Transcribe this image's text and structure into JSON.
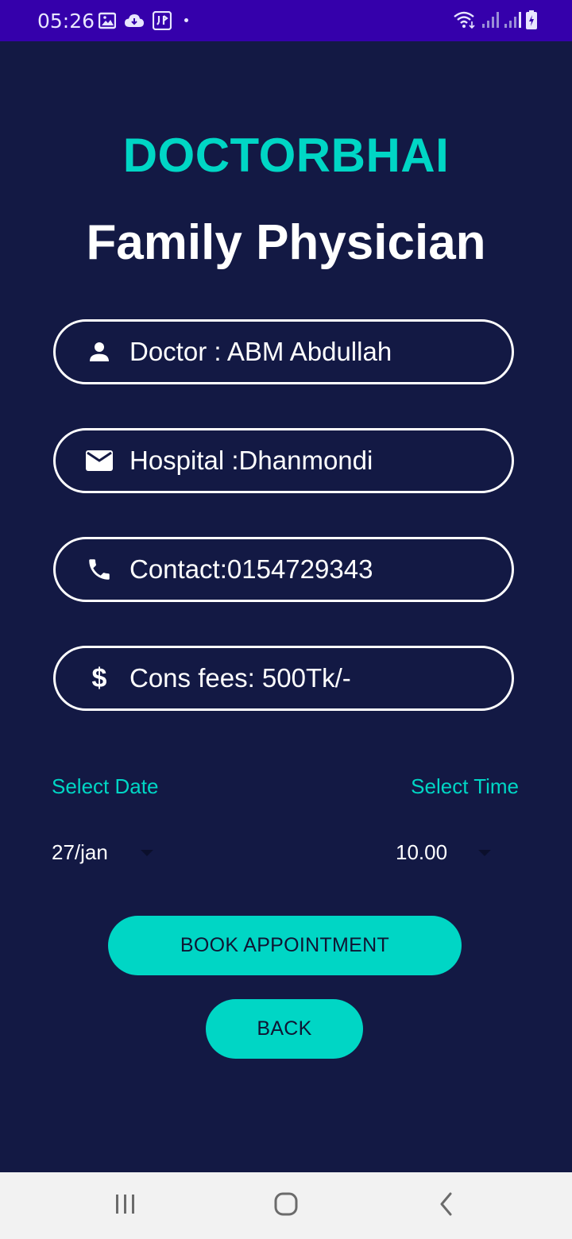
{
  "status_bar": {
    "time": "05:26",
    "left_icons": [
      "gallery-icon",
      "cloud-download-icon",
      "voicemail-icon"
    ],
    "right_icons": [
      "wifi-icon",
      "signal-icon",
      "signal-icon",
      "battery-charging-icon"
    ],
    "color": "#3500ab"
  },
  "header": {
    "brand": "DOCTORBHAI",
    "title": "Family Physician",
    "brand_color": "#00d6c5"
  },
  "fields": [
    {
      "icon": "person-icon",
      "text": "Doctor : ABM Abdullah"
    },
    {
      "icon": "mail-icon",
      "text": "Hospital :Dhanmondi"
    },
    {
      "icon": "phone-icon",
      "text": "Contact:0154729343"
    },
    {
      "icon": "dollar-icon",
      "glyph": "$",
      "text": "Cons fees: 500Tk/-"
    }
  ],
  "booking": {
    "date_label": "Select Date",
    "time_label": "Select Time",
    "date_value": "27/jan",
    "time_value": "10.00"
  },
  "buttons": {
    "book": "BOOK APPOINTMENT",
    "back": "BACK"
  },
  "nav_bar": {
    "items": [
      "recents-icon",
      "home-icon",
      "back-icon"
    ]
  },
  "colors": {
    "background": "#131944",
    "accent": "#00d6c5",
    "status_bar": "#3500ab"
  }
}
